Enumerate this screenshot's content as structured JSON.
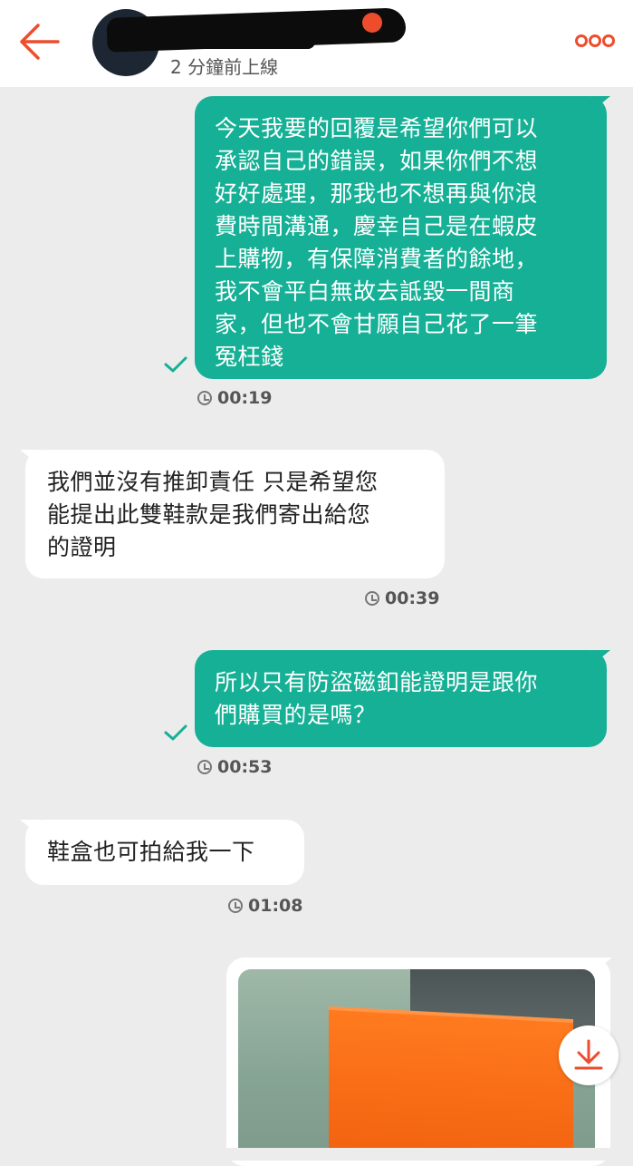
{
  "header": {
    "status": "2 分鐘前上線",
    "back_icon": "arrow-left-icon",
    "more_icon": "more-dots-icon",
    "accent_color": "#ee4d2d"
  },
  "messages": [
    {
      "direction": "outgoing",
      "lines": [
        "今天我要的回覆是希望你們可以",
        "承認自己的錯誤，如果你們不想",
        "好好處理，那我也不想再與你浪",
        "費時間溝通，慶幸自己是在蝦皮",
        "上購物，有保障消費者的餘地，",
        "我不會平白無故去詆毀一間商",
        "家，但也不會甘願自己花了一筆",
        "冤枉錢"
      ],
      "time": "00:19",
      "read": true
    },
    {
      "direction": "incoming",
      "lines": [
        "我們並沒有推卸責任 只是希望您",
        "能提出此雙鞋款是我們寄出給您",
        "的證明"
      ],
      "time": "00:39"
    },
    {
      "direction": "outgoing",
      "lines": [
        "所以只有防盜磁釦能證明是跟你",
        "們購買的是嗎？"
      ],
      "time": "00:53",
      "read": true
    },
    {
      "direction": "incoming",
      "lines": [
        "鞋盒也可拍給我一下"
      ],
      "time": "01:08"
    },
    {
      "direction": "outgoing",
      "type": "image",
      "download_icon": "download-icon"
    }
  ],
  "colors": {
    "outgoing_bubble": "#15b095",
    "incoming_bubble": "#ffffff",
    "background": "#ececec"
  }
}
